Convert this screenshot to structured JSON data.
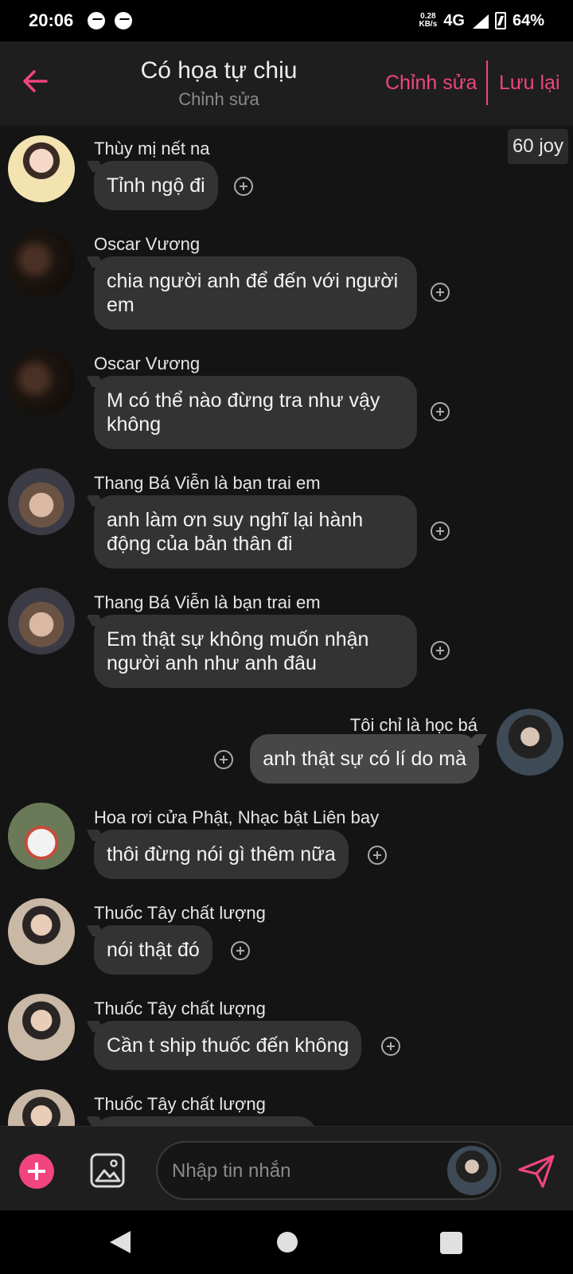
{
  "status_bar": {
    "time": "20:06",
    "speed_value": "0.28",
    "speed_unit": "KB/s",
    "network": "4G",
    "battery": "64%",
    "notification_icons": [
      "messenger-icon",
      "messenger-icon"
    ]
  },
  "header": {
    "title": "Có họa tự chịu",
    "subtitle": "Chỉnh sửa",
    "edit_label": "Chỉnh sửa",
    "save_label": "Lưu lại",
    "accent_color": "#f0457e"
  },
  "joy_badge": "60 joy",
  "messages": [
    {
      "sender": "Thùy mị nết na",
      "text": "Tỉnh ngộ đi",
      "outgoing": false
    },
    {
      "sender": "Oscar Vương",
      "text": "chia người anh để đến với người em",
      "outgoing": false
    },
    {
      "sender": "Oscar Vương",
      "text": "M có thể nào đừng tra như vậy không",
      "outgoing": false
    },
    {
      "sender": "Thang Bá Viễn là bạn trai em",
      "text": "anh làm ơn suy nghĩ lại hành động của bản thân đi",
      "outgoing": false
    },
    {
      "sender": "Thang Bá Viễn là bạn trai em",
      "text": "Em thật sự không muốn nhận người anh như anh đâu",
      "outgoing": false
    },
    {
      "sender": "Tôi chỉ là học bá",
      "text": "anh thật sự có lí do mà",
      "outgoing": true
    },
    {
      "sender": "Hoa rơi cửa Phật, Nhạc bật Liên bay",
      "text": "thôi đừng nói gì thêm nữa",
      "outgoing": false
    },
    {
      "sender": "Thuốc Tây chất lượng",
      "text": "nói thật đó",
      "outgoing": false
    },
    {
      "sender": "Thuốc Tây chất lượng",
      "text": "Cần t ship thuốc đến không",
      "outgoing": false
    },
    {
      "sender": "Thuốc Tây chất lượng",
      "text": "",
      "outgoing": false
    }
  ],
  "composer": {
    "placeholder": "Nhập tin nhắn"
  }
}
